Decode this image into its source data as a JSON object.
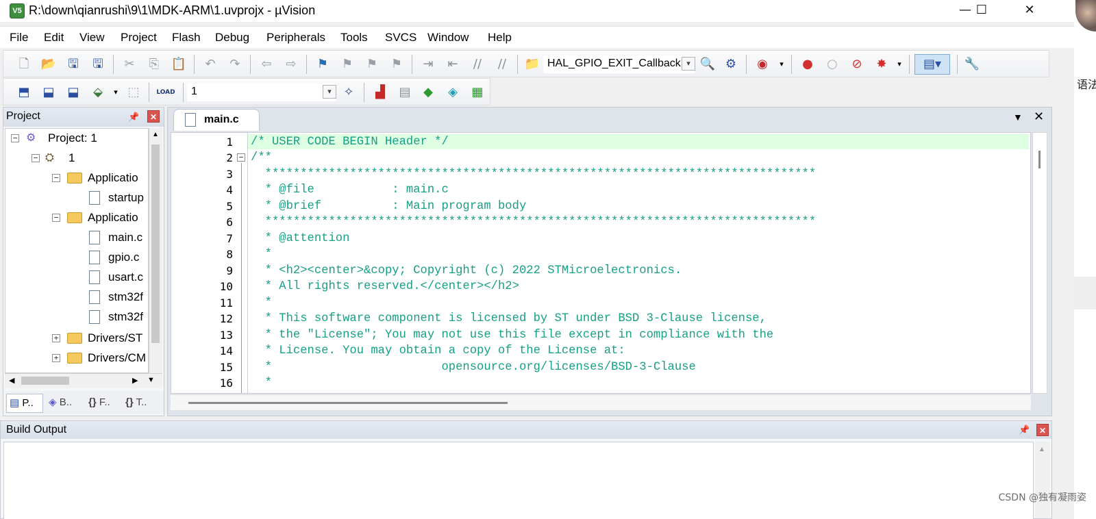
{
  "window": {
    "title": "R:\\down\\qianrushi\\9\\1\\MDK-ARM\\1.uvprojx - µVision",
    "controls": {
      "minimize": "—",
      "maximize": "☐",
      "close": "✕"
    }
  },
  "menu": [
    "File",
    "Edit",
    "View",
    "Project",
    "Flash",
    "Debug",
    "Peripherals",
    "Tools",
    "SVCS",
    "Window",
    "Help"
  ],
  "toolbar": {
    "function_combo": "HAL_GPIO_EXIT_Callback",
    "target_combo": "1",
    "load_label": "LOAD"
  },
  "project_panel": {
    "title": "Project",
    "tree": {
      "root": "Project: 1",
      "target": "1",
      "group1": "Applicatio",
      "group1_files": [
        "startup"
      ],
      "group2": "Applicatio",
      "group2_files": [
        "main.c",
        "gpio.c",
        "usart.c",
        "stm32f",
        "stm32f"
      ],
      "group3": "Drivers/ST",
      "group4": "Drivers/CM"
    },
    "tabs": [
      "P..",
      "B..",
      "F..",
      "T.."
    ]
  },
  "editor": {
    "tab_label": "main.c",
    "lines": [
      {
        "n": "1",
        "text": "/* USER CODE BEGIN Header */"
      },
      {
        "n": "2",
        "text": "/**"
      },
      {
        "n": "3",
        "text": "  ******************************************************************************"
      },
      {
        "n": "4",
        "text": "  * @file           : main.c"
      },
      {
        "n": "5",
        "text": "  * @brief          : Main program body"
      },
      {
        "n": "6",
        "text": "  ******************************************************************************"
      },
      {
        "n": "7",
        "text": "  * @attention"
      },
      {
        "n": "8",
        "text": "  *"
      },
      {
        "n": "9",
        "text": "  * <h2><center>&copy; Copyright (c) 2022 STMicroelectronics."
      },
      {
        "n": "10",
        "text": "  * All rights reserved.</center></h2>"
      },
      {
        "n": "11",
        "text": "  *"
      },
      {
        "n": "12",
        "text": "  * This software component is licensed by ST under BSD 3-Clause license,"
      },
      {
        "n": "13",
        "text": "  * the \"License\"; You may not use this file except in compliance with the"
      },
      {
        "n": "14",
        "text": "  * License. You may obtain a copy of the License at:"
      },
      {
        "n": "15",
        "text": "  *                        opensource.org/licenses/BSD-3-Clause"
      },
      {
        "n": "16",
        "text": "  *"
      }
    ]
  },
  "build_output": {
    "title": "Build Output"
  },
  "right_strip": {
    "text": "语法"
  },
  "watermark": "CSDN @独有凝雨姿",
  "colors": {
    "code_comment": "#16a085",
    "current_line": "#dfffe3",
    "panel_header": "#dbe2ec",
    "close_red": "#d9534f"
  }
}
